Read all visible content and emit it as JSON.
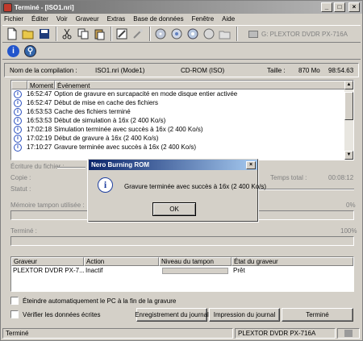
{
  "window": {
    "title": "Terminé - [ISO1.nri]",
    "minimize": "_",
    "maximize": "□",
    "close": "×"
  },
  "menu": [
    "Fichier",
    "Éditer",
    "Voir",
    "Graveur",
    "Extras",
    "Base de données",
    "Fenêtre",
    "Aide"
  ],
  "toolbar": {
    "drive_select": "G: PLEXTOR  DVDR   PX-716A"
  },
  "info": {
    "compilation_label": "Nom de la compilation :",
    "compilation_value": "ISO1.nri (Mode1)",
    "type": "CD-ROM (ISO)",
    "size_label": "Taille :",
    "size_value": "870 Mo",
    "time_value": "98:54.63"
  },
  "log": {
    "col_time": "Moment",
    "col_event": "Événement",
    "rows": [
      {
        "time": "16:52:47",
        "event": "Option de gravure en surcapacité en mode disque entier activée"
      },
      {
        "time": "16:52:47",
        "event": "Début de mise en cache des fichiers"
      },
      {
        "time": "16:53:53",
        "event": "Cache des fichiers terminé"
      },
      {
        "time": "16:53:53",
        "event": "Début de simulation à 16x (2 400 Ko/s)"
      },
      {
        "time": "17:02:18",
        "event": "Simulation terminée avec succès à 16x (2 400 Ko/s)"
      },
      {
        "time": "17:02:19",
        "event": "Début de gravure à 16x (2 400 Ko/s)"
      },
      {
        "time": "17:10:27",
        "event": "Gravure terminée avec succès à 16x (2 400 Ko/s)"
      }
    ]
  },
  "progress": {
    "writing_label": "Écriture du fichier :",
    "copy_label": "Copie :",
    "status_label": "Statut :",
    "total_time_label": "Temps total :",
    "total_time_value": "00:08:12",
    "buffer_label": "Mémoire tampon utilisée :",
    "buffer_pct": "0%",
    "done_label": "Terminé :",
    "done_pct": "100%"
  },
  "drives": {
    "col_recorder": "Graveur",
    "col_action": "Action",
    "col_buffer": "Niveau du tampon",
    "col_state": "État du graveur",
    "rows": [
      {
        "recorder": "PLEXTOR DVDR   PX-7...",
        "action": "Inactif",
        "state": "Prêt"
      }
    ]
  },
  "options": {
    "shutdown_label": "Éteindre automatiquement le PC à la fin de la gravure",
    "verify_label": "Vérifier les données écrites"
  },
  "buttons": {
    "save_log": "Enregistrement du journal",
    "print_log": "Impression du journal",
    "done": "Terminé"
  },
  "statusbar": {
    "left": "Terminé",
    "drive": "PLEXTOR  DVDR   PX-716A"
  },
  "dialog": {
    "title": "Nero Burning ROM",
    "message": "Gravure terminée avec succès à 16x (2 400 Ko/s)",
    "ok": "OK",
    "close": "×"
  }
}
